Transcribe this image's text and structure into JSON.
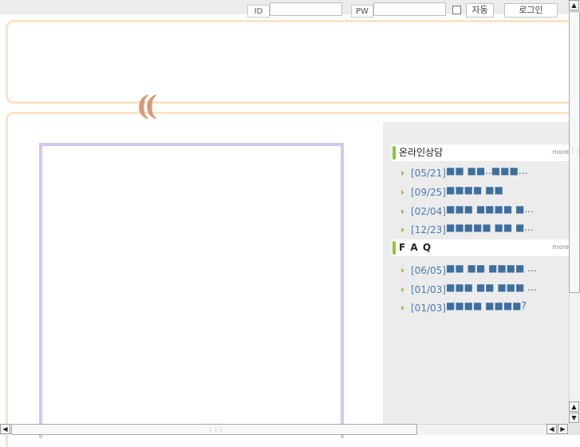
{
  "login": {
    "id_label": "ID",
    "id_value": "",
    "pw_label": "PW",
    "pw_value": "",
    "auto_label": "자동",
    "login_button": "로그인"
  },
  "decor": {
    "quote_mark": "(("
  },
  "sidebar": {
    "consult": {
      "title": "온라인상담",
      "more": "more",
      "items": [
        {
          "date": "[05/21]",
          "title": "■■ ■■..■■■..."
        },
        {
          "date": "[09/25]",
          "title": "■■■■ ■■"
        },
        {
          "date": "[02/04]",
          "title": "■■■ ■■■■ ■..."
        },
        {
          "date": "[12/23]",
          "title": "■■■■■ ■■ ■..."
        }
      ]
    },
    "faq": {
      "title": "F A Q",
      "more": "more",
      "items": [
        {
          "date": "[06/05]",
          "title": "■■ ■■ ■■■■ ..."
        },
        {
          "date": "[01/03]",
          "title": "■■■ ■■ ■■■ ..."
        },
        {
          "date": "[01/03]",
          "title": "■■■■ ■■■■?"
        }
      ]
    }
  },
  "scrollbar_icons": {
    "up": "▲",
    "down": "▼",
    "left": "◀",
    "right": "▶",
    "grip_v": "⋮⋮⋮",
    "grip_h": "⋮⋮⋮"
  },
  "colors": {
    "accent_green": "#8cc63f",
    "frame_orange": "#fbe3c6",
    "box_purple": "#d5c8ee",
    "link_blue": "#4a7bb5"
  }
}
